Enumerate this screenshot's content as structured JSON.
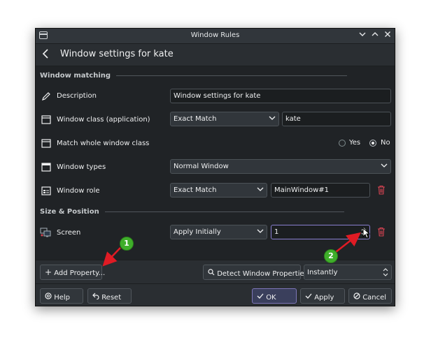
{
  "titlebar": {
    "title": "Window Rules"
  },
  "header": {
    "title": "Window settings for kate"
  },
  "sections": {
    "matching": "Window matching",
    "size_position": "Size & Position"
  },
  "rows": {
    "description": {
      "label": "Description",
      "value": "Window settings for kate"
    },
    "window_class": {
      "label": "Window class (application)",
      "match": "Exact Match",
      "value": "kate"
    },
    "whole_class": {
      "label": "Match whole window class",
      "yes": "Yes",
      "no": "No",
      "selected": "No"
    },
    "window_types": {
      "label": "Window types",
      "value": "Normal Window"
    },
    "window_role": {
      "label": "Window role",
      "match": "Exact Match",
      "value": "MainWindow#1"
    },
    "screen": {
      "label": "Screen",
      "policy": "Apply Initially",
      "value": "1"
    }
  },
  "footer": {
    "add_property": "Add Property...",
    "detect": "Detect Window Properties",
    "detect_delay": "Instantly"
  },
  "dialog_buttons": {
    "help": "Help",
    "reset": "Reset",
    "ok": "OK",
    "apply": "Apply",
    "cancel": "Cancel"
  },
  "annotations": {
    "one": "1",
    "two": "2",
    "color": "#3fae2a",
    "arrow_color": "#e01b24"
  },
  "colors": {
    "window_bg": "#2a2e32",
    "content_bg": "#202326",
    "accent": "#7d76b8",
    "delete": "#da4453"
  }
}
